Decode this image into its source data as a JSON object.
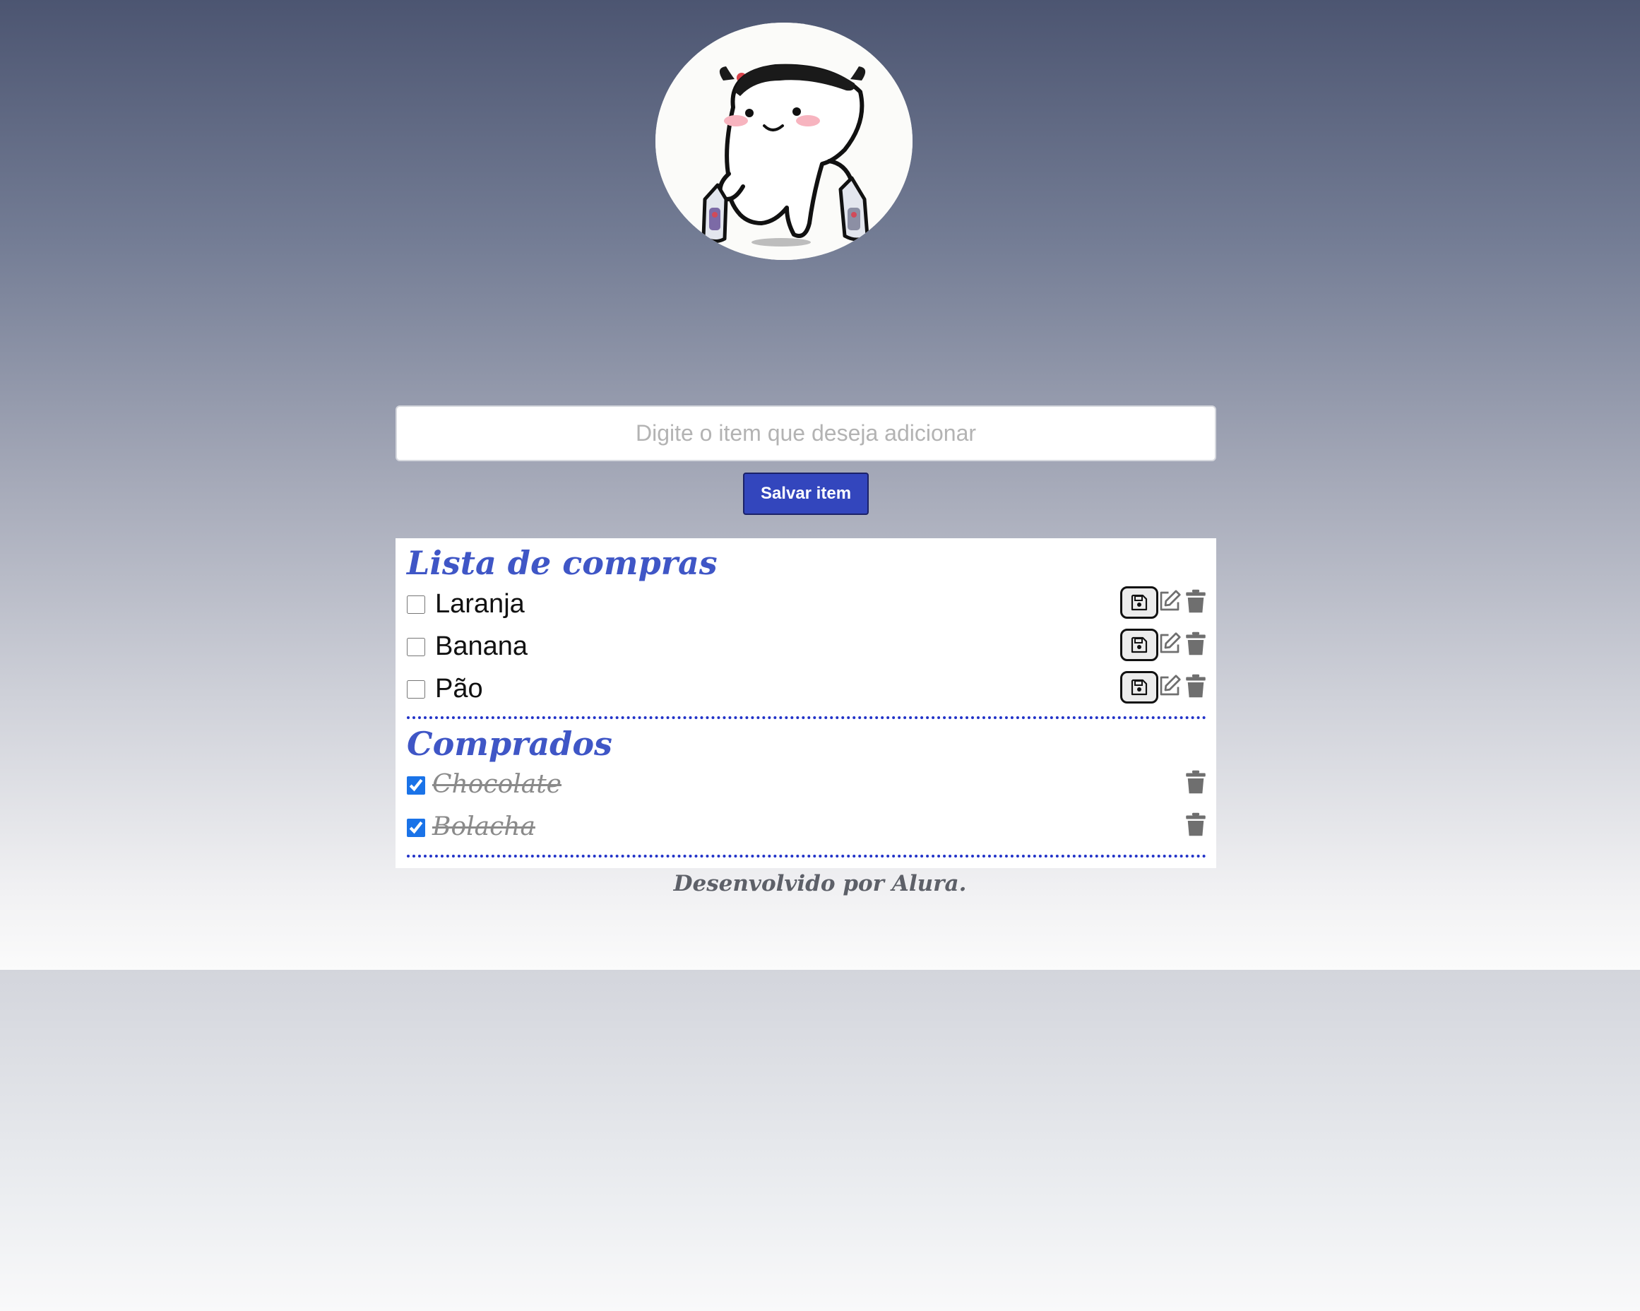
{
  "input": {
    "placeholder": "Digite o item que deseja adicionar"
  },
  "save_button": {
    "label": "Salvar item"
  },
  "pending_section": {
    "title": "Lista de compras",
    "items": [
      {
        "label": "Laranja",
        "checked": false
      },
      {
        "label": "Banana",
        "checked": false
      },
      {
        "label": "Pão",
        "checked": false
      }
    ]
  },
  "bought_section": {
    "title": "Comprados",
    "items": [
      {
        "label": "Chocolate",
        "checked": true
      },
      {
        "label": "Bolacha",
        "checked": true
      }
    ]
  },
  "footer": {
    "text": "Desenvolvido por Alura."
  },
  "colors": {
    "accent": "#3346bd",
    "title": "#3f56c6",
    "divider": "#2233c8",
    "hero_top": "#4c5571",
    "icon_gray": "#6f6f6f"
  },
  "icons": {
    "save": "floppy-disk-icon",
    "edit": "pencil-square-icon",
    "delete": "trash-icon"
  }
}
